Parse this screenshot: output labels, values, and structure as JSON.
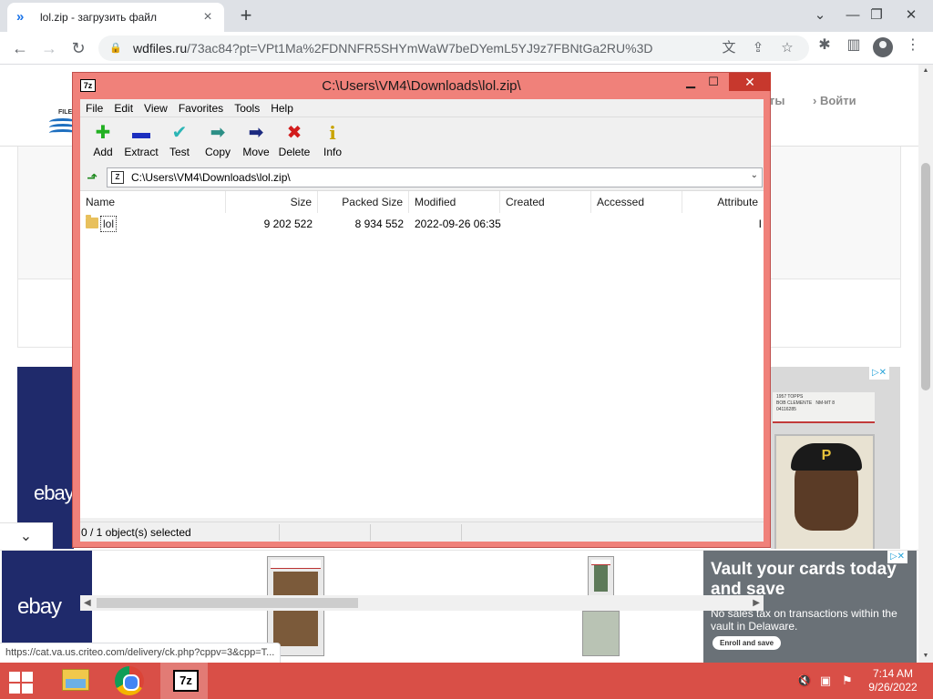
{
  "browser": {
    "tab_title": "lol.zip - загрузить файл",
    "tab_favicon": "chevron-double-right-icon",
    "new_tab": "+",
    "url_host": "wdfiles.ru",
    "url_rest": "/73ac84?pt=VPt1Ma%2FDNNFR5SHYmWaW7beDYemL5YJ9z7FBNtGa2RU%3D",
    "accent": "#1a73e8"
  },
  "website": {
    "logo_text": "FILE",
    "nav_fragment": "ты",
    "nav_login": "Войти",
    "ad_left_logo": "ebay",
    "ad_right_slab": "1957 TOPPS\nBOB CLEMENTE   NM-MT 8\n04116285",
    "ad_right_cap": "P",
    "bottom_ebay_logo": "ebay",
    "vault_headline": "Vault your cards today and save",
    "vault_sub": "No sales tax on transactions within the vault in Delaware.",
    "vault_button": "Enroll and save",
    "adchoices": "▷✕",
    "status_url": "https://cat.va.us.criteo.com/delivery/ck.php?cppv=3&cpp=T..."
  },
  "sevenzip": {
    "app_icon": "7z",
    "title": "C:\\Users\\VM4\\Downloads\\lol.zip\\",
    "menu": [
      "File",
      "Edit",
      "View",
      "Favorites",
      "Tools",
      "Help"
    ],
    "tools": [
      {
        "label": "Add",
        "icon": "plus-icon",
        "glyph": "✚",
        "color": "#22b022"
      },
      {
        "label": "Extract",
        "icon": "minus-icon",
        "glyph": "▬",
        "color": "#1c2fbf"
      },
      {
        "label": "Test",
        "icon": "check-icon",
        "glyph": "✔",
        "color": "#2bb5b5"
      },
      {
        "label": "Copy",
        "icon": "copy-arrow-icon",
        "glyph": "➡",
        "color": "#2c8f86"
      },
      {
        "label": "Move",
        "icon": "move-arrow-icon",
        "glyph": "➡",
        "color": "#1c2a80"
      },
      {
        "label": "Delete",
        "icon": "delete-x-icon",
        "glyph": "✖",
        "color": "#d21c1c"
      },
      {
        "label": "Info",
        "icon": "info-icon",
        "glyph": "i",
        "color": "#c9a400"
      }
    ],
    "address": "C:\\Users\\VM4\\Downloads\\lol.zip\\",
    "columns": [
      "Name",
      "Size",
      "Packed Size",
      "Modified",
      "Created",
      "Accessed",
      "Attribute"
    ],
    "rows": [
      {
        "name": "lol",
        "size": "9 202 522",
        "packed": "8 934 552",
        "modified": "2022-09-26 06:35",
        "created": "",
        "accessed": "",
        "attr": "I"
      }
    ],
    "status": "0 / 1 object(s) selected"
  },
  "taskbar": {
    "app_7z": "7z",
    "time": "7:14 AM",
    "date": "9/26/2022",
    "bg": "#d94f47"
  }
}
